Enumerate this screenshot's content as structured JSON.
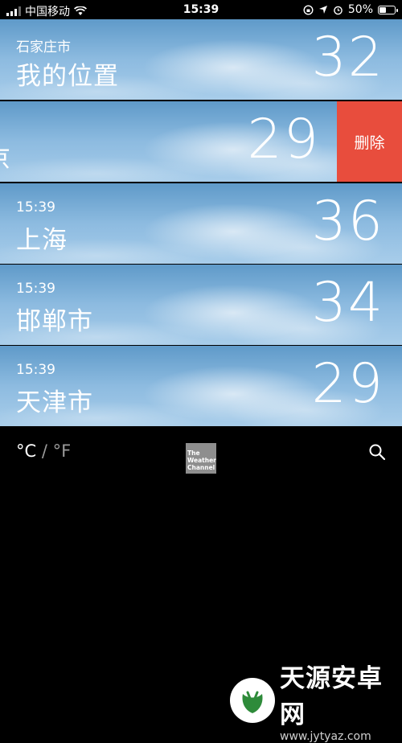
{
  "status_bar": {
    "carrier": "中国移动",
    "time": "15:39",
    "battery": "50%",
    "battery_level": 0.5
  },
  "cities": [
    {
      "small_label": "石家庄市",
      "name": "我的位置",
      "temp": "32"
    },
    {
      "small_label": "",
      "name": "京",
      "temp": "29",
      "swiped": true,
      "action_label": "删除"
    },
    {
      "small_label": "15:39",
      "name": "上海",
      "temp": "36"
    },
    {
      "small_label": "15:39",
      "name": "邯郸市",
      "temp": "34"
    },
    {
      "small_label": "15:39",
      "name": "天津市",
      "temp": "29"
    }
  ],
  "bottom_bar": {
    "celsius": "°C",
    "separator": "/",
    "fahrenheit": "°F",
    "logo_line1": "The",
    "logo_line2": "Weather",
    "logo_line3": "Channel"
  },
  "watermark": {
    "title": "天源安卓网",
    "url": "www.jytyaz.com"
  },
  "colors": {
    "delete": "#e84d3d",
    "sky_top": "#5f9ac9",
    "sky_bottom": "#a8cdea",
    "background": "#000000"
  }
}
